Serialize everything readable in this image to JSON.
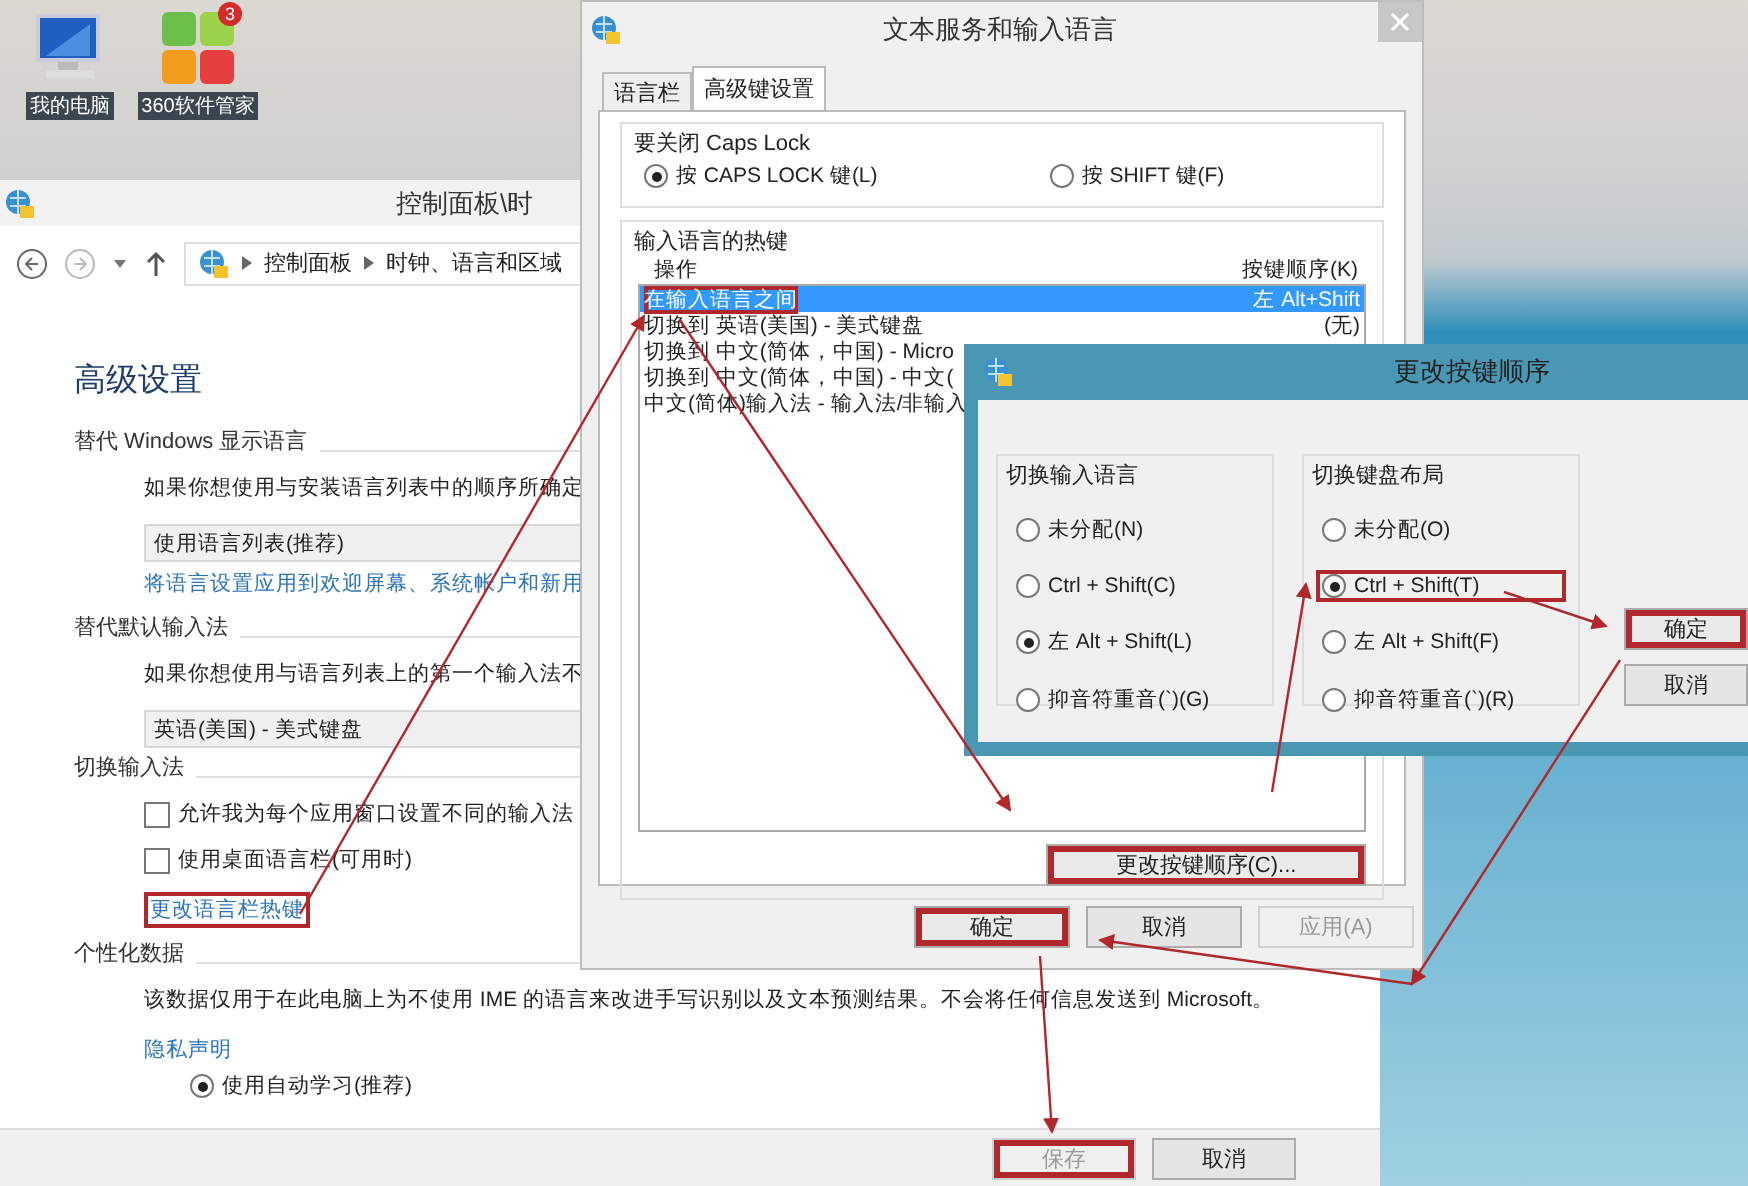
{
  "desktop_icons": [
    {
      "label": "我的电脑",
      "kind": "computer"
    },
    {
      "label": "360软件管家",
      "kind": "app",
      "badge": "3"
    }
  ],
  "control_panel": {
    "title": "控制面板\\时",
    "breadcrumb": [
      "控制面板",
      "时钟、语言和区域"
    ],
    "heading": "高级设置",
    "sections": [
      {
        "title": "替代 Windows 显示语言",
        "items": [
          {
            "kind": "text",
            "text": "如果你想使用与安装语言列表中的顺序所确定"
          },
          {
            "kind": "dropdown",
            "text": "使用语言列表(推荐)"
          },
          {
            "kind": "link",
            "text": "将语言设置应用到欢迎屏幕、系统帐户和新用",
            "highlighted": false
          }
        ]
      },
      {
        "title": "替代默认输入法",
        "items": [
          {
            "kind": "text",
            "text": "如果你想使用与语言列表上的第一个输入法不"
          },
          {
            "kind": "dropdown",
            "text": "英语(美国) - 美式键盘"
          }
        ]
      },
      {
        "title": "切换输入法",
        "items": [
          {
            "kind": "checkbox",
            "text": "允许我为每个应用窗口设置不同的输入法",
            "checked": false
          },
          {
            "kind": "checkbox",
            "text": "使用桌面语言栏(可用时)",
            "checked": false
          },
          {
            "kind": "link",
            "text": "更改语言栏热键",
            "highlighted": true
          }
        ]
      },
      {
        "title": "个性化数据",
        "items": [
          {
            "kind": "text",
            "text": "该数据仅用于在此电脑上为不使用 IME 的语言来改进手写识别以及文本预测结果。不会将任何信息发送到 Microsoft。"
          },
          {
            "kind": "link",
            "text": "隐私声明",
            "highlighted": false
          },
          {
            "kind": "radio",
            "text": "使用自动学习(推荐)",
            "selected": true
          }
        ]
      }
    ],
    "buttons": [
      {
        "label": "保存",
        "disabled": true,
        "highlighted": true
      },
      {
        "label": "取消",
        "disabled": false,
        "highlighted": false
      }
    ]
  },
  "text_services_dialog": {
    "title": "文本服务和输入语言",
    "tabs": [
      {
        "label": "语言栏",
        "selected": false
      },
      {
        "label": "高级键设置",
        "selected": true
      }
    ],
    "caps_lock": {
      "title": "要关闭 Caps Lock",
      "options": [
        {
          "label": "按 CAPS LOCK 键(L)",
          "selected": true
        },
        {
          "label": "按 SHIFT 键(F)",
          "selected": false
        }
      ]
    },
    "hotkeys": {
      "title": "输入语言的热键",
      "columns": [
        "操作",
        "按键顺序(K)"
      ],
      "rows": [
        {
          "action": "在输入语言之间",
          "keys": "左 Alt+Shift",
          "selected": true,
          "highlighted": true
        },
        {
          "action": "切换到 英语(美国) - 美式键盘",
          "keys": "(无)",
          "selected": false,
          "highlighted": false
        },
        {
          "action": "切换到 中文(简体，中国) - Micro",
          "selected": false,
          "highlighted": false
        },
        {
          "action": "切换到 中文(简体，中国) - 中文(",
          "selected": false,
          "highlighted": false
        },
        {
          "action": "中文(简体)输入法 - 输入法/非输入",
          "selected": false,
          "highlighted": false
        }
      ],
      "change_button": {
        "label": "更改按键顺序(C)...",
        "highlighted": true
      }
    },
    "buttons": [
      {
        "label": "确定",
        "disabled": false,
        "highlighted": true
      },
      {
        "label": "取消",
        "disabled": false,
        "highlighted": false
      },
      {
        "label": "应用(A)",
        "disabled": true,
        "highlighted": false
      }
    ]
  },
  "change_dialog": {
    "title": "更改按键顺序",
    "groups": [
      {
        "title": "切换输入语言",
        "options": [
          {
            "label": "未分配(N)",
            "selected": false,
            "highlighted": false
          },
          {
            "label": "Ctrl + Shift(C)",
            "selected": false,
            "highlighted": false
          },
          {
            "label": "左 Alt + Shift(L)",
            "selected": true,
            "highlighted": false
          },
          {
            "label": "抑音符重音(`)(G)",
            "selected": false,
            "highlighted": false
          }
        ]
      },
      {
        "title": "切换键盘布局",
        "options": [
          {
            "label": "未分配(O)",
            "selected": false,
            "highlighted": false
          },
          {
            "label": "Ctrl + Shift(T)",
            "selected": true,
            "highlighted": true
          },
          {
            "label": "左 Alt + Shift(F)",
            "selected": false,
            "highlighted": false
          },
          {
            "label": "抑音符重音(`)(R)",
            "selected": false,
            "highlighted": false
          }
        ]
      }
    ],
    "buttons": [
      {
        "label": "确定",
        "highlighted": true
      },
      {
        "label": "取消",
        "highlighted": false
      }
    ]
  }
}
